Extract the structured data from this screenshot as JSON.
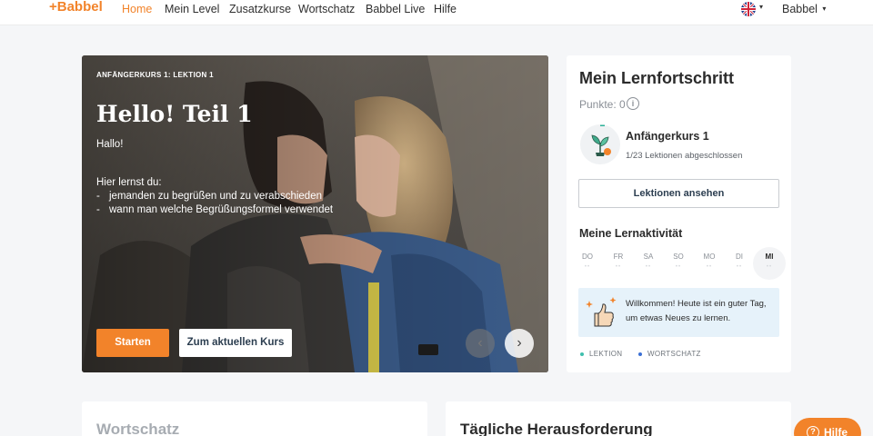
{
  "nav": {
    "logo": "+Babbel",
    "items": [
      "Home",
      "Mein Level",
      "Zusatzkurse",
      "Wortschatz",
      "Babbel Live",
      "Hilfe"
    ],
    "user": "Babbel",
    "caret": "▾"
  },
  "hero": {
    "kicker": "ANFÄNGERKURS 1: LEKTION 1",
    "title": "Hello! Teil 1",
    "greeting": "Hallo!",
    "learn_heading": "Hier lernst du:",
    "bullet_dash": "-",
    "bullets": [
      "jemanden zu begrüßen und zu verabschieden",
      "wann man welche Begrüßungsformel verwendet"
    ],
    "start_label": "Starten",
    "course_label": "Zum aktuellen Kurs",
    "prev_icon": "‹",
    "next_icon": "›"
  },
  "progress": {
    "title": "Mein Lernfortschritt",
    "points": "Punkte: 0",
    "info_icon": "i",
    "course_name": "Anfängerkurs 1",
    "course_status": "1/23 Lektionen abgeschlossen",
    "view_lessons_label": "Lektionen ansehen",
    "activity_title": "Meine Lernaktivität",
    "days": [
      "DO",
      "FR",
      "SA",
      "SO",
      "MO",
      "DI",
      "MI"
    ],
    "day_dots": "••",
    "welcome": "Willkommen! Heute ist ein guter Tag, um etwas Neues zu lernen.",
    "legend": [
      {
        "label": "LEKTION",
        "color": "#3fbfad"
      },
      {
        "label": "WORTSCHATZ",
        "color": "#3b6fd4"
      }
    ]
  },
  "bottom": {
    "vocab_title": "Wortschatz",
    "challenge_title": "Tägliche Herausforderung"
  },
  "help": {
    "label": "Hilfe",
    "icon": "?"
  },
  "colors": {
    "accent": "#f2832a",
    "navy": "#2c3e50"
  }
}
